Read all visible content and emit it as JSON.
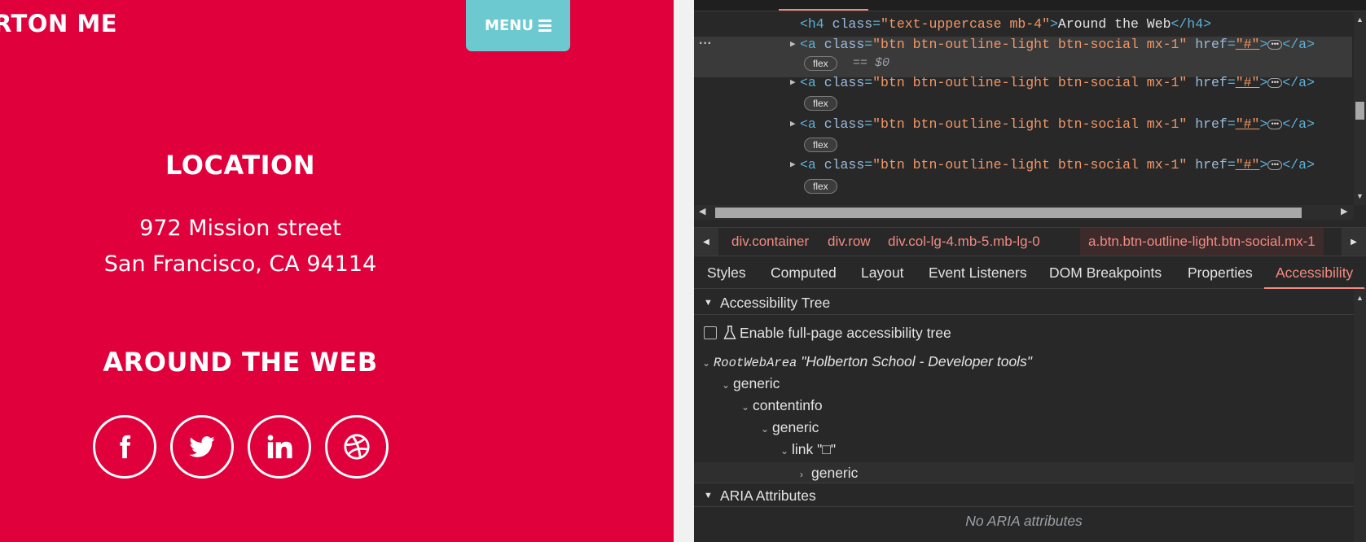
{
  "site": {
    "brand": "RTON ME",
    "menu_label": "MENU",
    "location_title": "LOCATION",
    "address_line1": "972 Mission street",
    "address_line2": "San Francisco, CA 94114",
    "web_title": "AROUND THE WEB",
    "socials": [
      "facebook-icon",
      "twitter-icon",
      "linkedin-icon",
      "dribbble-icon"
    ],
    "bg_color": "#e0003c",
    "menu_color": "#6cc9d0"
  },
  "devtools": {
    "elements": {
      "h4_open": "<h4 ",
      "h4_attr": "class",
      "h4_val": "\"text-uppercase mb-4\"",
      "h4_text": "Around the Web",
      "h4_close": "</h4>",
      "a_open": "<a ",
      "a_class_attr": "class",
      "a_class_val": "\"btn btn-outline-light btn-social mx-1\"",
      "a_href_attr": "href",
      "a_href_val": "\"#\"",
      "a_close": "</a>",
      "flex_badge": "flex",
      "selected_marker": "== $0"
    },
    "breadcrumbs": [
      "div.container",
      "div.row",
      "div.col-lg-4.mb-5.mb-lg-0",
      "a.btn.btn-outline-light.btn-social.mx-1"
    ],
    "subtabs": [
      "Styles",
      "Computed",
      "Layout",
      "Event Listeners",
      "DOM Breakpoints",
      "Properties",
      "Accessibility"
    ],
    "active_subtab": "Accessibility",
    "accessibility_tree_header": "Accessibility Tree",
    "enable_full_page_label": "Enable full-page accessibility tree",
    "tree": {
      "root_role": "RootWebArea",
      "root_name": "\"Holberton School - Developer tools\"",
      "generic1": "generic",
      "contentinfo": "contentinfo",
      "generic2": "generic",
      "link_role": "link",
      "link_name": "\"□\"",
      "generic3": "generic"
    },
    "aria_header": "ARIA Attributes",
    "aria_empty": "No ARIA attributes",
    "accent_color": "#f28b82"
  }
}
